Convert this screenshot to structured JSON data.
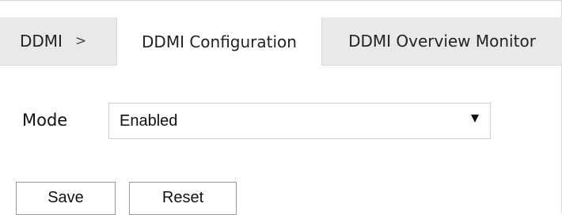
{
  "breadcrumb": {
    "root": "DDMI",
    "separator": ">"
  },
  "tabs": [
    {
      "label": "DDMI Configuration",
      "active": true
    },
    {
      "label": "DDMI Overview Monitor",
      "active": false
    }
  ],
  "form": {
    "mode_label": "Mode",
    "mode_value": "Enabled"
  },
  "buttons": {
    "save": "Save",
    "reset": "Reset"
  },
  "colors": {
    "tabbar_bg": "#e9e9e9",
    "active_tab_bg": "#ffffff",
    "border": "#d9d9d9"
  }
}
